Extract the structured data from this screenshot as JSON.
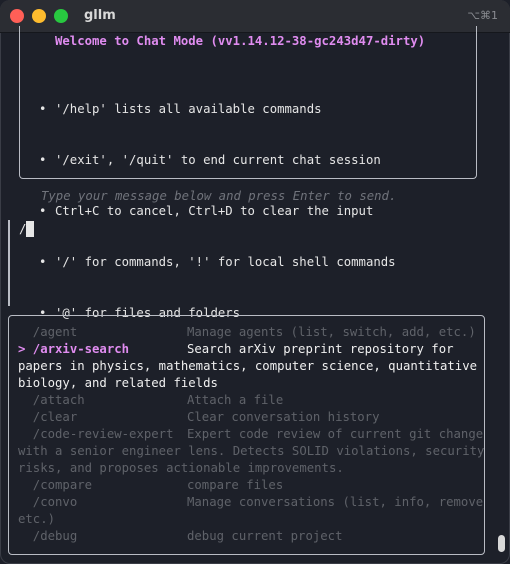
{
  "window": {
    "title": "gllm",
    "shortcut": "⌥⌘1"
  },
  "welcome": {
    "title": "Welcome to Chat Mode (vv1.14.12-38-gc243d47-dirty)",
    "bullets": [
      "'/help' lists all available commands",
      "'/exit', '/quit' to end current chat session",
      "Ctrl+C to cancel, Ctrl+D to clear the input",
      "'/' for commands, '!' for local shell commands",
      "'@' for files and folders"
    ],
    "bullet_glyph": "•"
  },
  "hint": "Type your message below and press Enter to send.",
  "input": {
    "value": "/"
  },
  "menu": {
    "items": [
      {
        "cmd": "  /agent",
        "desc": "Manage agents (list, switch, add, etc.)",
        "wrap": [],
        "selected": false
      },
      {
        "cmd": "> /arxiv-search",
        "desc": "Search arXiv preprint repository for",
        "wrap": [
          "papers in physics, mathematics, computer science, quantitative",
          "biology, and related fields"
        ],
        "selected": true
      },
      {
        "cmd": "  /attach",
        "desc": "Attach a file",
        "wrap": [],
        "selected": false
      },
      {
        "cmd": "  /clear",
        "desc": "Clear conversation history",
        "wrap": [],
        "selected": false
      },
      {
        "cmd": "  /code-review-expert",
        "desc": "Expert code review of current git changes",
        "wrap": [
          "with a senior engineer lens. Detects SOLID violations, security",
          "risks, and proposes actionable improvements."
        ],
        "selected": false
      },
      {
        "cmd": "  /compare",
        "desc": "compare files",
        "wrap": [],
        "selected": false
      },
      {
        "cmd": "  /convo",
        "desc": "Manage conversations (list, info, remove,",
        "wrap": [
          "etc.)"
        ],
        "selected": false
      },
      {
        "cmd": "  /debug",
        "desc": "debug current project",
        "wrap": [],
        "selected": false
      }
    ]
  }
}
